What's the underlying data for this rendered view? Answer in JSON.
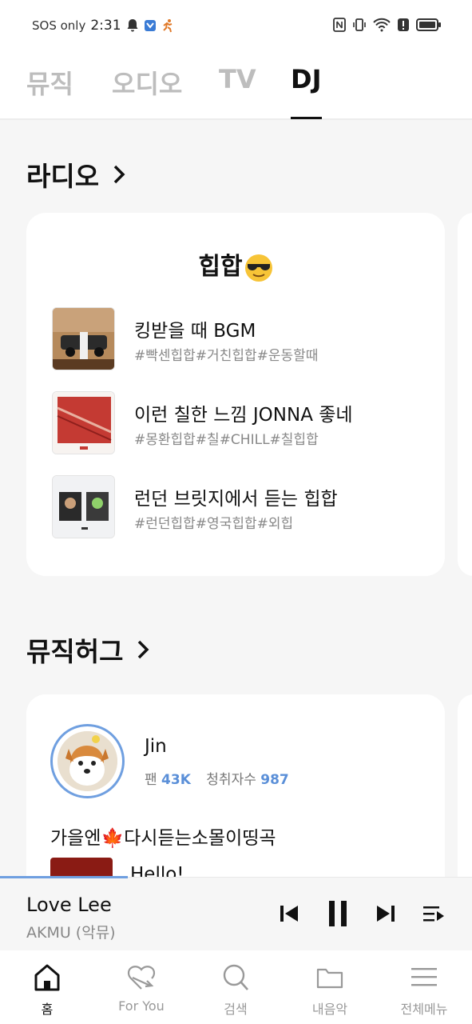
{
  "status_bar": {
    "carrier": "SOS only",
    "time": "2:31",
    "icons": [
      "bell-icon",
      "app-shield-icon",
      "runner-icon",
      "nfc-icon",
      "vibrate-icon",
      "wifi-icon",
      "alert-icon",
      "battery-icon"
    ]
  },
  "tabs": [
    {
      "label": "뮤직",
      "active": false
    },
    {
      "label": "오디오",
      "active": false
    },
    {
      "label": "TV",
      "active": false
    },
    {
      "label": "DJ",
      "active": true
    }
  ],
  "radio": {
    "section_title": "라디오",
    "card_title": "힙합",
    "items": [
      {
        "title": "킹받을 때 BGM",
        "tags": "#빡센힙합#거친힙합#운동할때"
      },
      {
        "title": "이런 칠한 느낌 JONNA 좋네",
        "tags": "#몽환힙합#칠#CHILL#칠힙합"
      },
      {
        "title": "런던 브릿지에서 듣는 힙합",
        "tags": "#런던힙합#영국힙합#외힙"
      }
    ]
  },
  "musichug": {
    "section_title": "뮤직허그",
    "user_name": "Jin",
    "fans_label": "팬",
    "fans_value": "43K",
    "listeners_label": "청취자수",
    "listeners_value": "987",
    "description": "가을엔🍁다시듣는소몰이띵곡",
    "song_partial": "Hello!"
  },
  "player": {
    "title": "Love Lee",
    "artist": "AKMU (악뮤)",
    "progress_fraction": 0.27
  },
  "bottom_nav": [
    {
      "label": "홈",
      "icon": "home-icon",
      "active": true
    },
    {
      "label": "For You",
      "icon": "heart-arrow-icon",
      "active": false
    },
    {
      "label": "검색",
      "icon": "search-icon",
      "active": false
    },
    {
      "label": "내음악",
      "icon": "folder-icon",
      "active": false
    },
    {
      "label": "전체메뉴",
      "icon": "menu-icon",
      "active": false
    }
  ],
  "colors": {
    "accent": "#6f9fe0",
    "inactive_tab": "#bdbdbd",
    "tag_gray": "#888888"
  }
}
